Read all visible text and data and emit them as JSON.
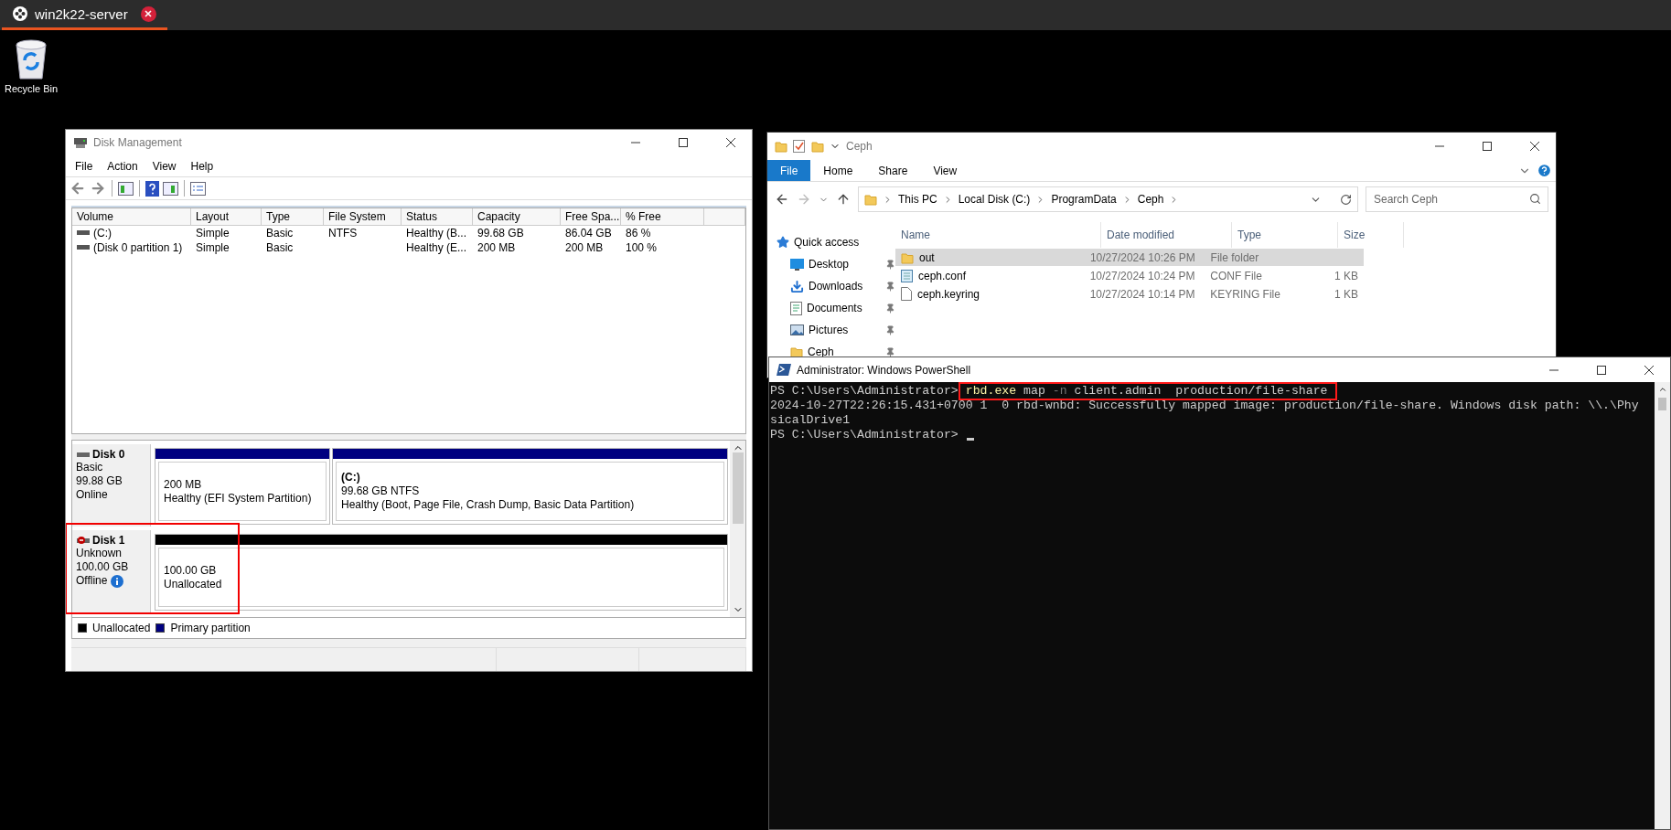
{
  "browser_tab": {
    "title": "win2k22-server",
    "selected": true
  },
  "desktop_icons": [
    {
      "label": "Recycle Bin"
    }
  ],
  "disk_management": {
    "title": "Disk Management",
    "menu": [
      "File",
      "Action",
      "View",
      "Help"
    ],
    "columns": [
      "Volume",
      "Layout",
      "Type",
      "File System",
      "Status",
      "Capacity",
      "Free Spa...",
      "% Free"
    ],
    "rows": [
      {
        "volume": "(C:)",
        "layout": "Simple",
        "type": "Basic",
        "file_system": "NTFS",
        "status": "Healthy (B...",
        "capacity": "99.68 GB",
        "free_space": "86.04 GB",
        "percent_free": "86 %"
      },
      {
        "volume": "(Disk 0 partition 1)",
        "layout": "Simple",
        "type": "Basic",
        "status": "Healthy (E...",
        "capacity": "200 MB",
        "free_space": "200 MB",
        "percent_free": "100 %"
      }
    ],
    "disks": [
      {
        "name": "Disk 0",
        "type": "Basic",
        "size": "99.88 GB",
        "status": "Online",
        "offline": false,
        "highlighted": false,
        "partitions": [
          {
            "kind": "primary",
            "size": "200 MB",
            "status": "Healthy (EFI System Partition)"
          },
          {
            "kind": "primary",
            "drive": "(C:)",
            "size": "99.68 GB NTFS",
            "status": "Healthy (Boot, Page File, Crash Dump, Basic Data Partition)"
          }
        ]
      },
      {
        "name": "Disk 1",
        "type": "Unknown",
        "size": "100.00 GB",
        "status": "Offline",
        "offline": true,
        "highlighted": true,
        "partitions": [
          {
            "kind": "unallocated",
            "size": "100.00 GB",
            "status": "Unallocated"
          }
        ]
      }
    ],
    "legend": [
      {
        "label": "Unallocated",
        "color": "#000000"
      },
      {
        "label": "Primary partition",
        "color": "#000080"
      }
    ]
  },
  "explorer": {
    "title": "Ceph",
    "ribbon_tabs": [
      {
        "label": "File",
        "selected": true
      },
      {
        "label": "Home",
        "selected": false
      },
      {
        "label": "Share",
        "selected": false
      },
      {
        "label": "View",
        "selected": false
      }
    ],
    "breadcrumb": [
      "This PC",
      "Local Disk (C:)",
      "ProgramData",
      "Ceph"
    ],
    "search": {
      "placeholder": "Search Ceph"
    },
    "nav": [
      {
        "label": "Quick access",
        "kind": "star",
        "pinned": false
      },
      {
        "label": "Desktop",
        "kind": "desktop",
        "pinned": true
      },
      {
        "label": "Downloads",
        "kind": "download",
        "pinned": true
      },
      {
        "label": "Documents",
        "kind": "documents",
        "pinned": true
      },
      {
        "label": "Pictures",
        "kind": "pictures",
        "pinned": true
      },
      {
        "label": "Ceph",
        "kind": "folder",
        "pinned": true
      }
    ],
    "columns": [
      "Name",
      "Date modified",
      "Type",
      "Size"
    ],
    "files": [
      {
        "name": "out",
        "kind": "folder",
        "date": "10/27/2024 10:26 PM",
        "type": "File folder",
        "selected": true
      },
      {
        "name": "ceph.conf",
        "kind": "config",
        "date": "10/27/2024 10:24 PM",
        "type": "CONF File",
        "size": "1 KB",
        "selected": false
      },
      {
        "name": "ceph.keyring",
        "kind": "file",
        "date": "10/27/2024 10:14 PM",
        "type": "KEYRING File",
        "size": "1 KB",
        "selected": false
      }
    ]
  },
  "powershell": {
    "title": "Administrator: Windows PowerShell",
    "lines": [
      {
        "prompt": "PS C:\\Users\\Administrator>",
        "highlighted": true,
        "command": [
          {
            "text": "rbd.exe",
            "kind": "exe"
          },
          {
            "text": "map",
            "kind": "arg"
          },
          {
            "text": "-n",
            "kind": "flag"
          },
          {
            "text": "client.admin",
            "kind": "arg"
          },
          {
            "text": " production/file-share",
            "kind": "arg"
          }
        ]
      },
      {
        "output": "2024-10-27T22:26:15.431+0700 1  0 rbd-wnbd: Successfully mapped image: production/file-share. Windows disk path: \\\\.\\Phy"
      },
      {
        "output": "sicalDrive1"
      },
      {
        "prompt": "PS C:\\Users\\Administrator>",
        "cursor": true
      }
    ]
  }
}
